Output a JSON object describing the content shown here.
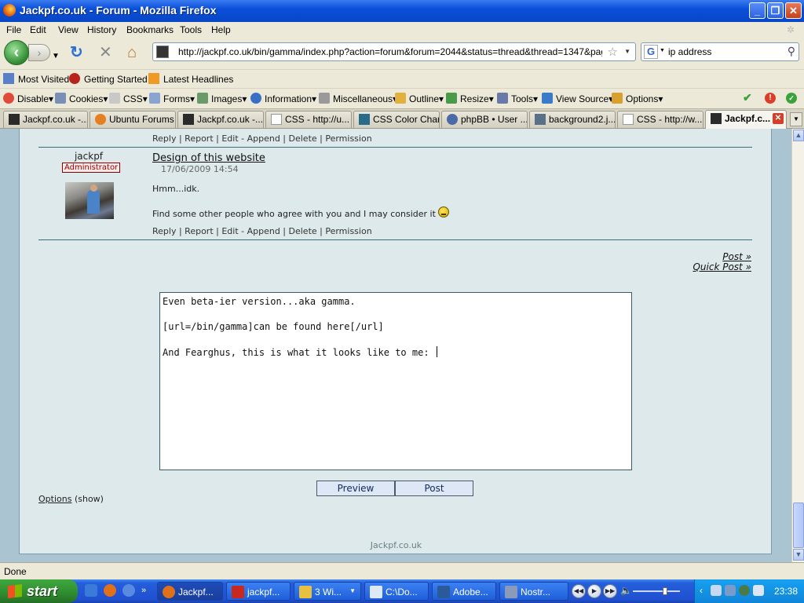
{
  "window": {
    "title": "Jackpf.co.uk - Forum - Mozilla Firefox"
  },
  "menu": [
    "File",
    "Edit",
    "View",
    "History",
    "Bookmarks",
    "Tools",
    "Help"
  ],
  "nav": {
    "url": "http://jackpf.co.uk/bin/gamma/index.php?action=forum&forum=2044&status=thread&thread=1347&page=2#",
    "search_query": "ip address"
  },
  "bookmarks": [
    "Most Visited",
    "Getting Started",
    "Latest Headlines"
  ],
  "devbar": [
    "Disable",
    "Cookies",
    "CSS",
    "Forms",
    "Images",
    "Information",
    "Miscellaneous",
    "Outline",
    "Resize",
    "Tools",
    "View Source",
    "Options"
  ],
  "tabs": [
    {
      "label": "Jackpf.co.uk -..."
    },
    {
      "label": "Ubuntu Forums"
    },
    {
      "label": "Jackpf.co.uk -..."
    },
    {
      "label": "CSS - http://u..."
    },
    {
      "label": "CSS Color Chart"
    },
    {
      "label": "phpBB • User ..."
    },
    {
      "label": "background2.j..."
    },
    {
      "label": "CSS - http://w..."
    },
    {
      "label": "Jackpf.c..."
    }
  ],
  "post_prev": {
    "actions": "Reply | Report | Edit - Append | Delete | Permission"
  },
  "post": {
    "username": "jackpf",
    "role": "Administrator",
    "title": "Design of this website",
    "date": "17/06/2009 14:54",
    "line1": "Hmm...idk.",
    "line2": "Find some other people who agree with you and I may consider it",
    "actions": "Reply | Report | Edit - Append | Delete | Permission"
  },
  "links": {
    "post": "Post »",
    "quick_post": "Quick Post »"
  },
  "editor": {
    "lines": [
      "Even beta-ier version...aka gamma.",
      "",
      "[url=/bin/gamma]can be found here[/url]",
      "",
      "And Fearghus, this is what it looks like to me: "
    ]
  },
  "buttons": {
    "preview": "Preview",
    "post": "Post"
  },
  "options": {
    "label": "Options",
    "toggle": "(show)"
  },
  "footer": "Jackpf.co.uk",
  "status": "Done",
  "taskbar": {
    "start": "start",
    "items": [
      "Jackpf...",
      "jackpf...",
      "3 Wi...",
      "C:\\Do...",
      "Adobe...",
      "Nostr..."
    ],
    "clock": "23:38"
  }
}
